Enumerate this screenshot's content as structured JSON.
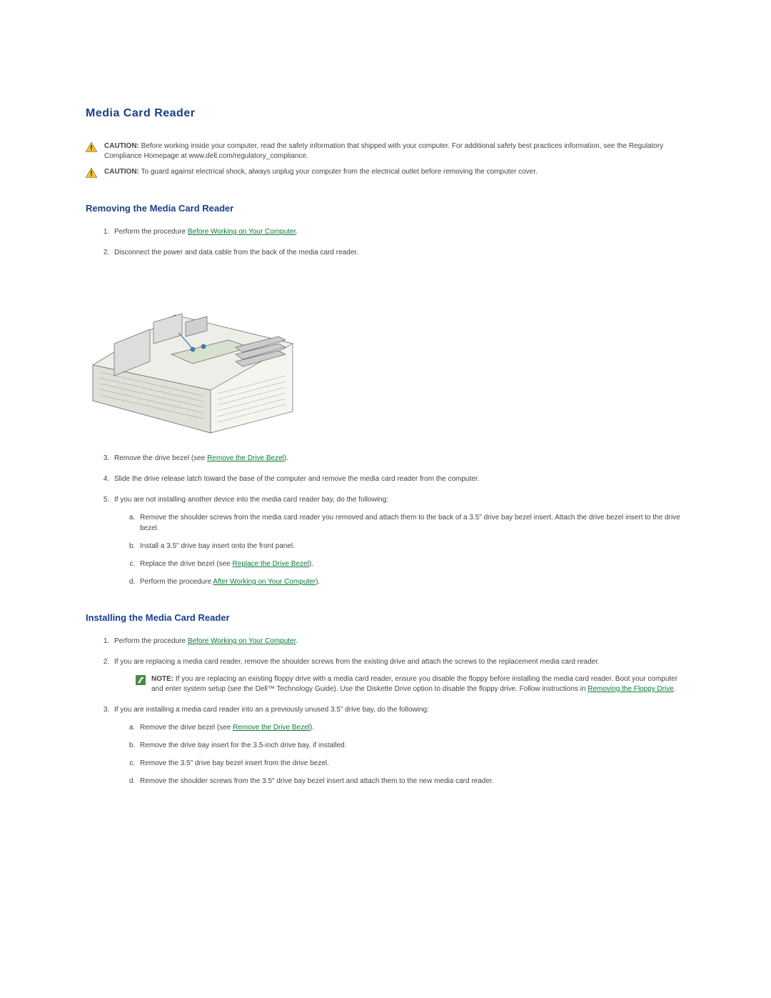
{
  "title": "Media Card Reader",
  "caution1": {
    "label": "CAUTION:",
    "text": " Before working inside your computer, read the safety information that shipped with your computer. For additional safety best practices information, see the Regulatory Compliance Homepage at www.dell.com/regulatory_compliance."
  },
  "caution2": {
    "label": "CAUTION:",
    "text": " To guard against electrical shock, always unplug your computer from the electrical outlet before removing the computer cover."
  },
  "removing": {
    "heading": "Removing the Media Card Reader",
    "step1_pre": "Perform the procedure ",
    "step1_link": "Before Working on Your Computer",
    "step1_post": ".",
    "step2": "Disconnect the power and data cable from the back of the media card reader.",
    "step3_pre": "Remove the drive bezel (see ",
    "step3_link": "Remove the Drive Bezel",
    "step3_post": ").",
    "step4": "Slide the drive release latch toward the base of the computer and remove the media card reader from the computer.",
    "step5": "If you are not installing another device into the media card reader bay, do the following:",
    "step5a": "Remove the shoulder screws from the media card reader you removed and attach them to the back of a 3.5\" drive bay bezel insert. Attach the drive bezel insert to the drive bezel.",
    "step5b": "Install a 3.5\" drive bay insert onto the front panel.",
    "step5c_pre": "Replace the drive bezel (see ",
    "step5c_link": "Replace the Drive Bezel",
    "step5c_post": ").",
    "step5d_pre": "Perform the procedure ",
    "step5d_link": "After Working on Your Computer",
    "step5d_post": ")."
  },
  "installing": {
    "heading": "Installing the Media Card Reader",
    "step1_pre": "Perform the procedure ",
    "step1_link": "Before Working on Your Computer",
    "step1_post": ".",
    "step2": "If you are replacing a media card reader, remove the shoulder screws from the existing drive and attach the screws to the replacement media card reader.",
    "note_label": "NOTE:",
    "note_text_pre": " If you are replacing an existing floppy drive with a media card reader, ensure you disable the floppy before installing the media card reader. Boot your computer and enter system setup (see the Dell™ Technology Guide). Use the Diskette Drive option to disable the floppy drive. Follow instructions in ",
    "note_link": "Removing the Floppy Drive",
    "note_text_post": ".",
    "step3": "If you are installing a media card reader into an a previously unused 3.5\" drive bay, do the following:",
    "step3a_pre": "Remove the drive bezel (see ",
    "step3a_link": "Remove the Drive Bezel",
    "step3a_post": ").",
    "step3b": "Remove the drive bay insert for the 3.5-inch drive bay, if installed.",
    "step3c": "Remove the 3.5\" drive bay bezel insert from the drive bezel.",
    "step3d": "Remove the shoulder screws from the 3.5\" drive bay bezel insert and attach them to the new media card reader."
  }
}
